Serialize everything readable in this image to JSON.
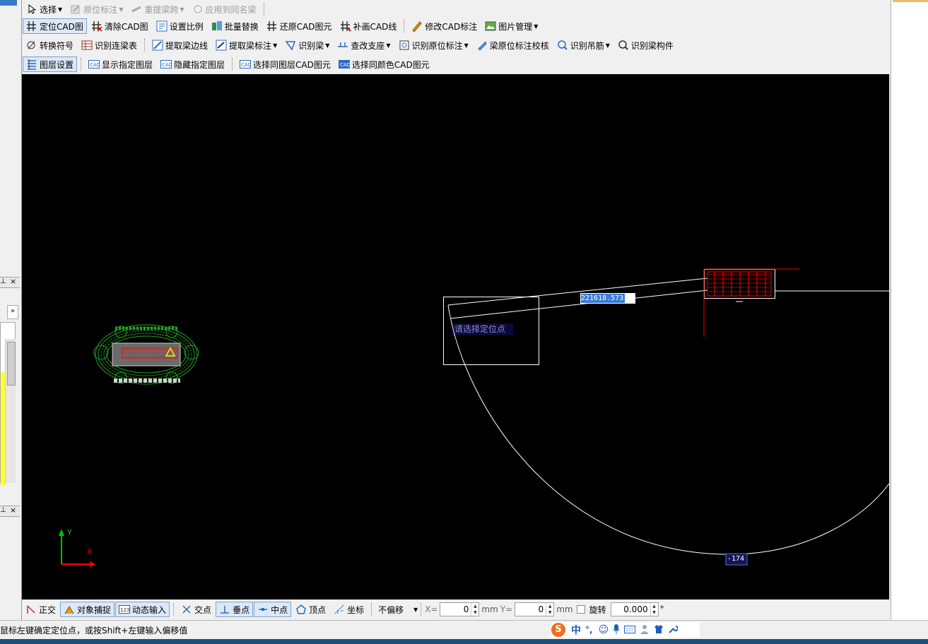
{
  "toolbar1": {
    "select": "选择",
    "orig_mark": "原位标注",
    "relift_span": "重提梁跨",
    "apply_same": "应用到同名梁"
  },
  "toolbar2": {
    "locate_cad": "定位CAD图",
    "clear_cad": "清除CAD图",
    "set_scale": "设置比例",
    "batch_replace": "批量替换",
    "restore_cad": "还原CAD图元",
    "patch_cad_line": "补画CAD线",
    "modify_cad_mark": "修改CAD标注",
    "image_manage": "图片管理"
  },
  "toolbar3": {
    "convert_symbol": "转换符号",
    "identify_beam_table": "识别连梁表",
    "extract_beam_edge": "提取梁边线",
    "extract_beam_mark": "提取梁标注",
    "identify_beam": "识别梁",
    "check_support": "查改支座",
    "identify_orig_mark": "识别原位标注",
    "beam_mark_check": "梁原位标注校核",
    "identify_hanger": "识别吊筋",
    "identify_beam_member": "识别梁构件"
  },
  "toolbar4": {
    "layer_settings": "图层设置",
    "show_layer": "显示指定图层",
    "hide_layer": "隐藏指定图层",
    "select_same_layer": "选择同图层CAD图元",
    "select_same_color": "选择同颜色CAD图元"
  },
  "canvas": {
    "distance_value": "221618.573",
    "prompt": "请选择定位点",
    "angle_value": "-174",
    "axis_x": "X",
    "axis_y": "Y"
  },
  "statusbar": {
    "ortho": "正交",
    "snap": "对象捕捉",
    "dynamic_input": "动态输入",
    "intersection": "交点",
    "perpendicular": "垂点",
    "midpoint": "中点",
    "vertex": "顶点",
    "coordinate": "坐标",
    "offset_mode": "不偏移",
    "x_label": "X=",
    "x_value": "0",
    "y_label": "Y=",
    "y_value": "0",
    "unit": "mm",
    "rotate_label": "旋转",
    "rotate_value": "0.000",
    "degree": "°"
  },
  "message": "鼠标左键确定定位点，或按Shift+左键输入偏移值",
  "ime": {
    "logo": "S",
    "lang": "中",
    "punct": "°,"
  },
  "colors": {
    "canvas_bg": "#000000",
    "cad_red": "#ff0000",
    "cad_green": "#1fa01f",
    "input_highlight": "#3a7bd5",
    "taskbar": "#1b4f7a"
  }
}
